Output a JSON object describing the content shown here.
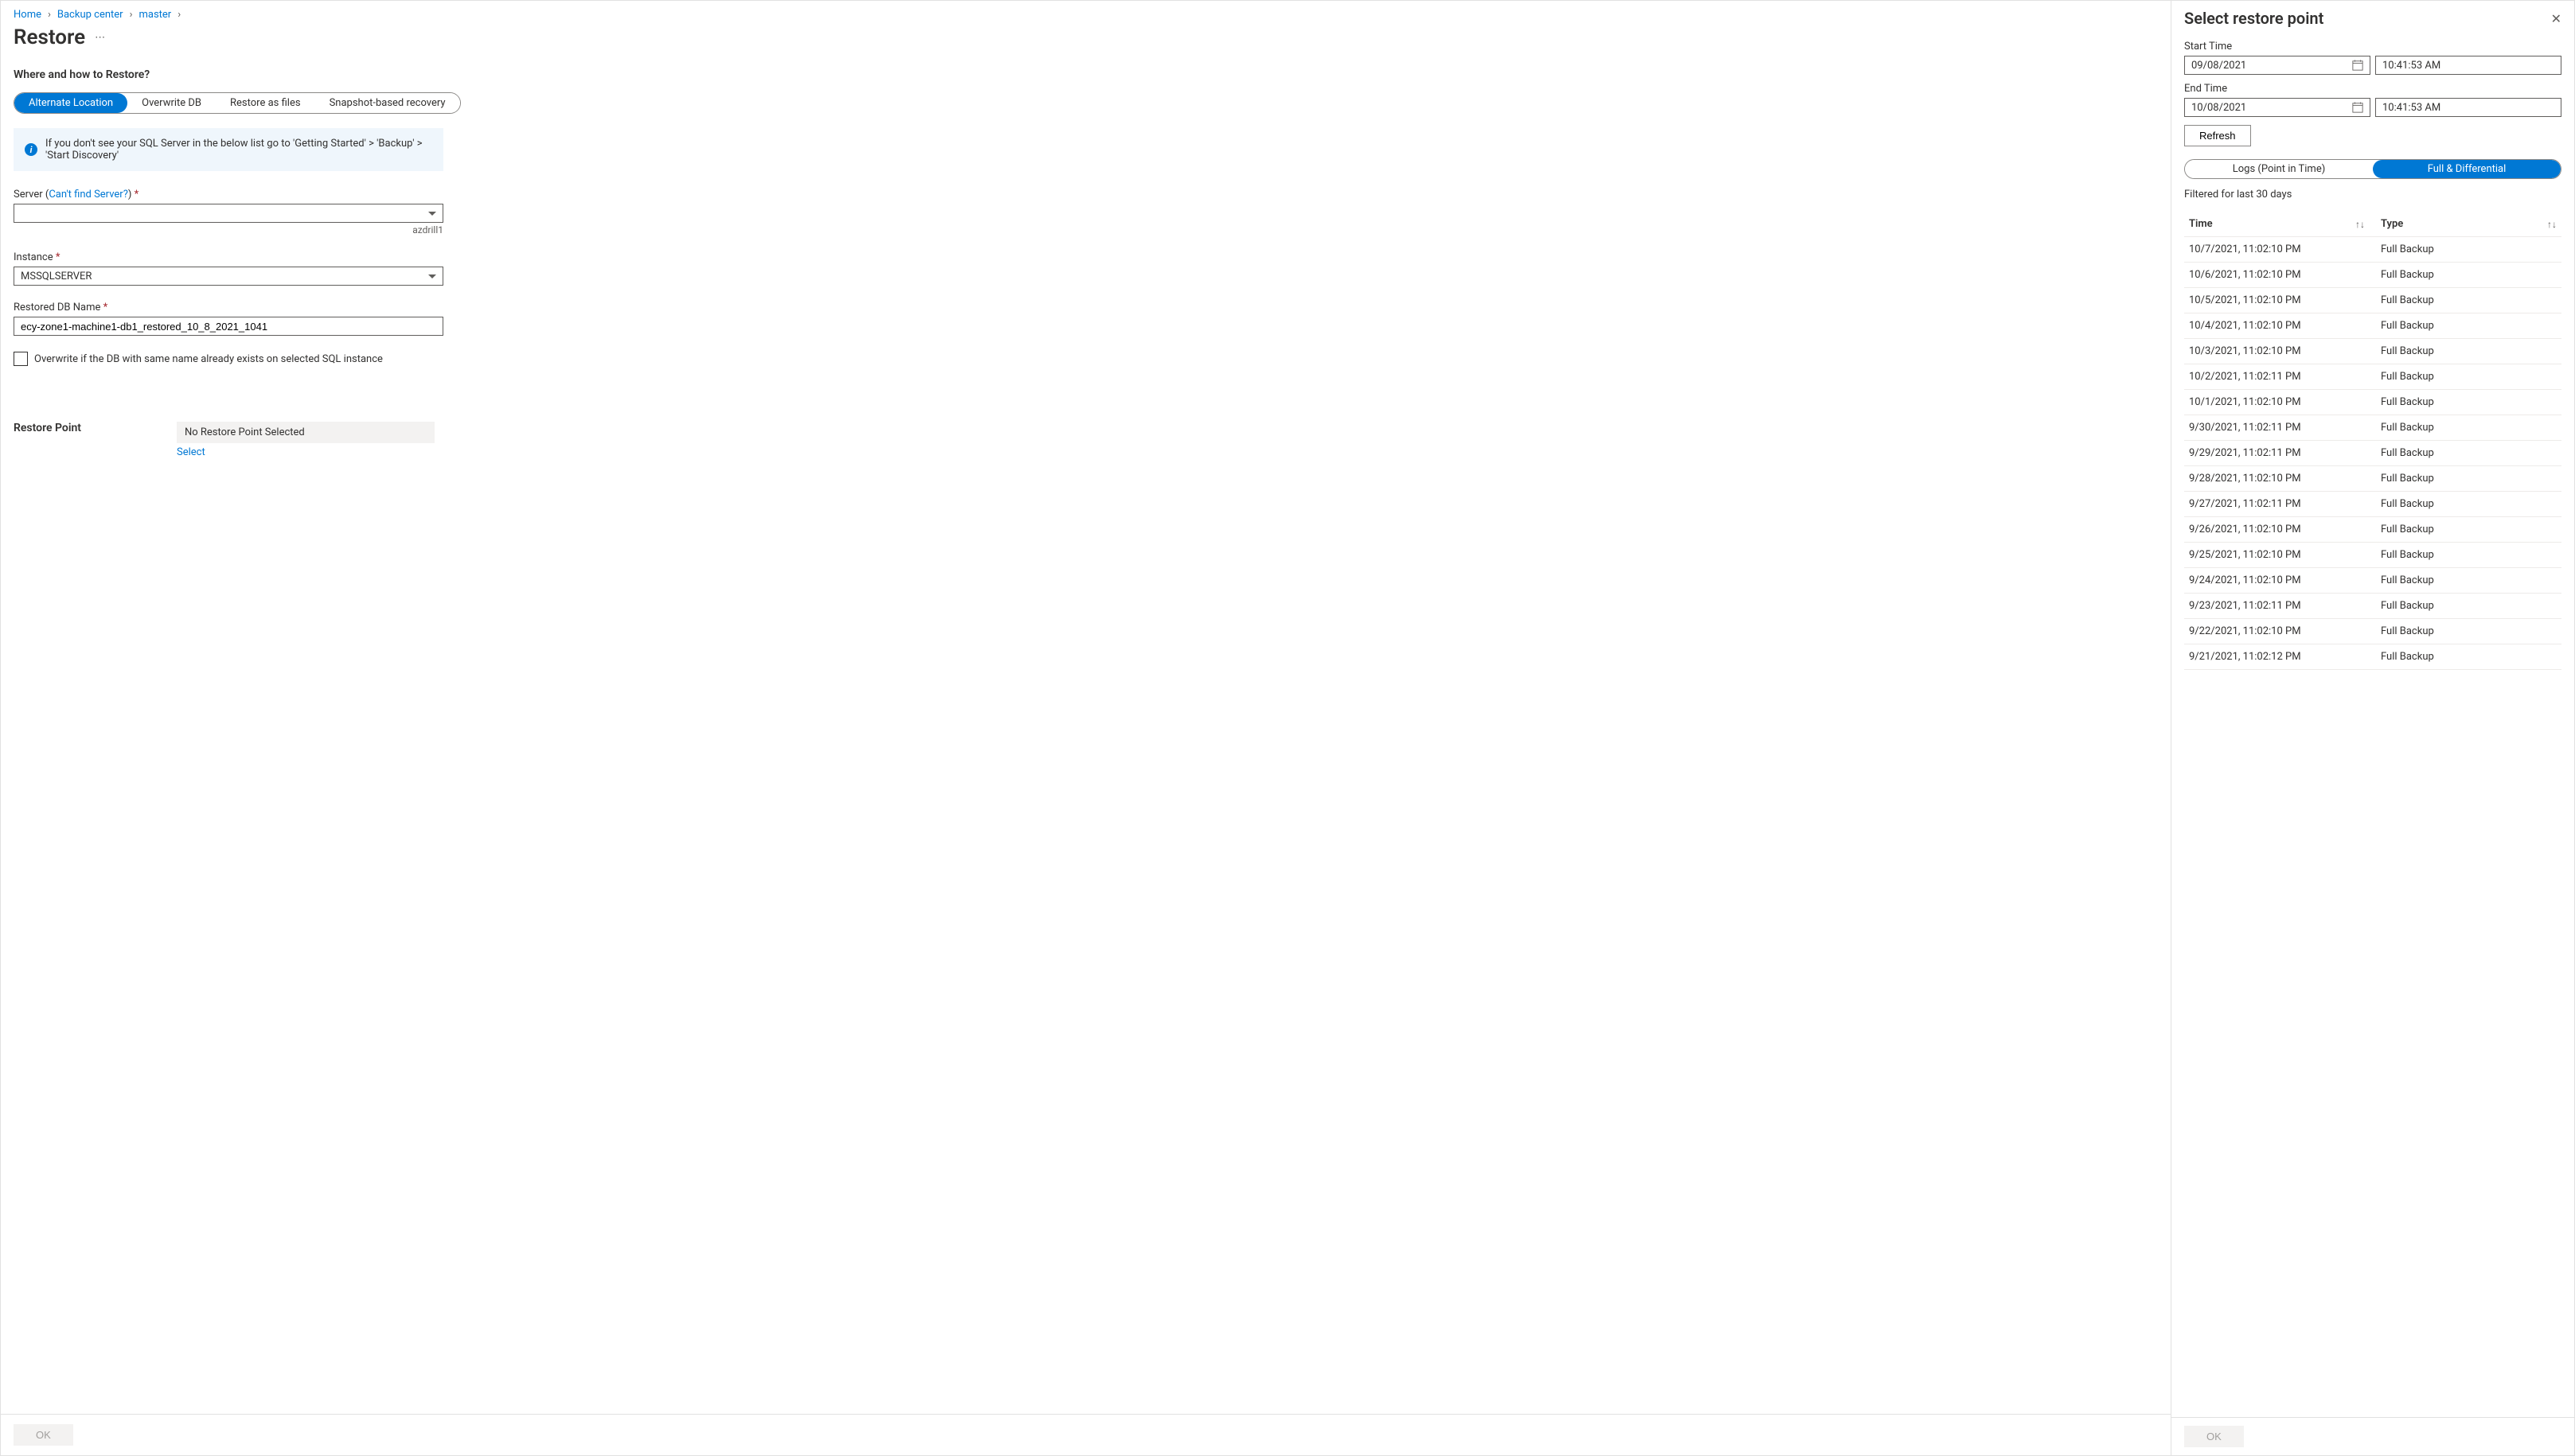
{
  "breadcrumb": {
    "home": "Home",
    "backup_center": "Backup center",
    "master": "master"
  },
  "page_title": "Restore",
  "section_heading": "Where and how to Restore?",
  "restore_tabs": [
    "Alternate Location",
    "Overwrite DB",
    "Restore as files",
    "Snapshot-based recovery"
  ],
  "info_message": "If you don't see your SQL Server in the below list go to 'Getting Started' > 'Backup' > 'Start Discovery'",
  "server": {
    "label": "Server (",
    "link": "Can't find Server?",
    "label_close": ")",
    "value": "",
    "helper": "azdrill1"
  },
  "instance": {
    "label": "Instance",
    "value": "MSSQLSERVER"
  },
  "restored_db": {
    "label": "Restored DB Name",
    "value": "ecy-zone1-machine1-db1_restored_10_8_2021_1041"
  },
  "overwrite_checkbox": "Overwrite if the DB with same name already exists on selected SQL instance",
  "restore_point": {
    "label": "Restore Point",
    "value": "No Restore Point Selected",
    "select": "Select"
  },
  "ok": "OK",
  "panel": {
    "title": "Select restore point",
    "start_time_label": "Start Time",
    "start_date": "09/08/2021",
    "start_time": "10:41:53 AM",
    "end_time_label": "End Time",
    "end_date": "10/08/2021",
    "end_time": "10:41:53 AM",
    "refresh": "Refresh",
    "tabs": [
      "Logs (Point in Time)",
      "Full & Differential"
    ],
    "filter_note": "Filtered for last 30 days",
    "col_time": "Time",
    "col_type": "Type",
    "rows": [
      {
        "time": "10/7/2021, 11:02:10 PM",
        "type": "Full Backup"
      },
      {
        "time": "10/6/2021, 11:02:10 PM",
        "type": "Full Backup"
      },
      {
        "time": "10/5/2021, 11:02:10 PM",
        "type": "Full Backup"
      },
      {
        "time": "10/4/2021, 11:02:10 PM",
        "type": "Full Backup"
      },
      {
        "time": "10/3/2021, 11:02:10 PM",
        "type": "Full Backup"
      },
      {
        "time": "10/2/2021, 11:02:11 PM",
        "type": "Full Backup"
      },
      {
        "time": "10/1/2021, 11:02:10 PM",
        "type": "Full Backup"
      },
      {
        "time": "9/30/2021, 11:02:11 PM",
        "type": "Full Backup"
      },
      {
        "time": "9/29/2021, 11:02:11 PM",
        "type": "Full Backup"
      },
      {
        "time": "9/28/2021, 11:02:10 PM",
        "type": "Full Backup"
      },
      {
        "time": "9/27/2021, 11:02:11 PM",
        "type": "Full Backup"
      },
      {
        "time": "9/26/2021, 11:02:10 PM",
        "type": "Full Backup"
      },
      {
        "time": "9/25/2021, 11:02:10 PM",
        "type": "Full Backup"
      },
      {
        "time": "9/24/2021, 11:02:10 PM",
        "type": "Full Backup"
      },
      {
        "time": "9/23/2021, 11:02:11 PM",
        "type": "Full Backup"
      },
      {
        "time": "9/22/2021, 11:02:10 PM",
        "type": "Full Backup"
      },
      {
        "time": "9/21/2021, 11:02:12 PM",
        "type": "Full Backup"
      }
    ],
    "ok": "OK"
  }
}
